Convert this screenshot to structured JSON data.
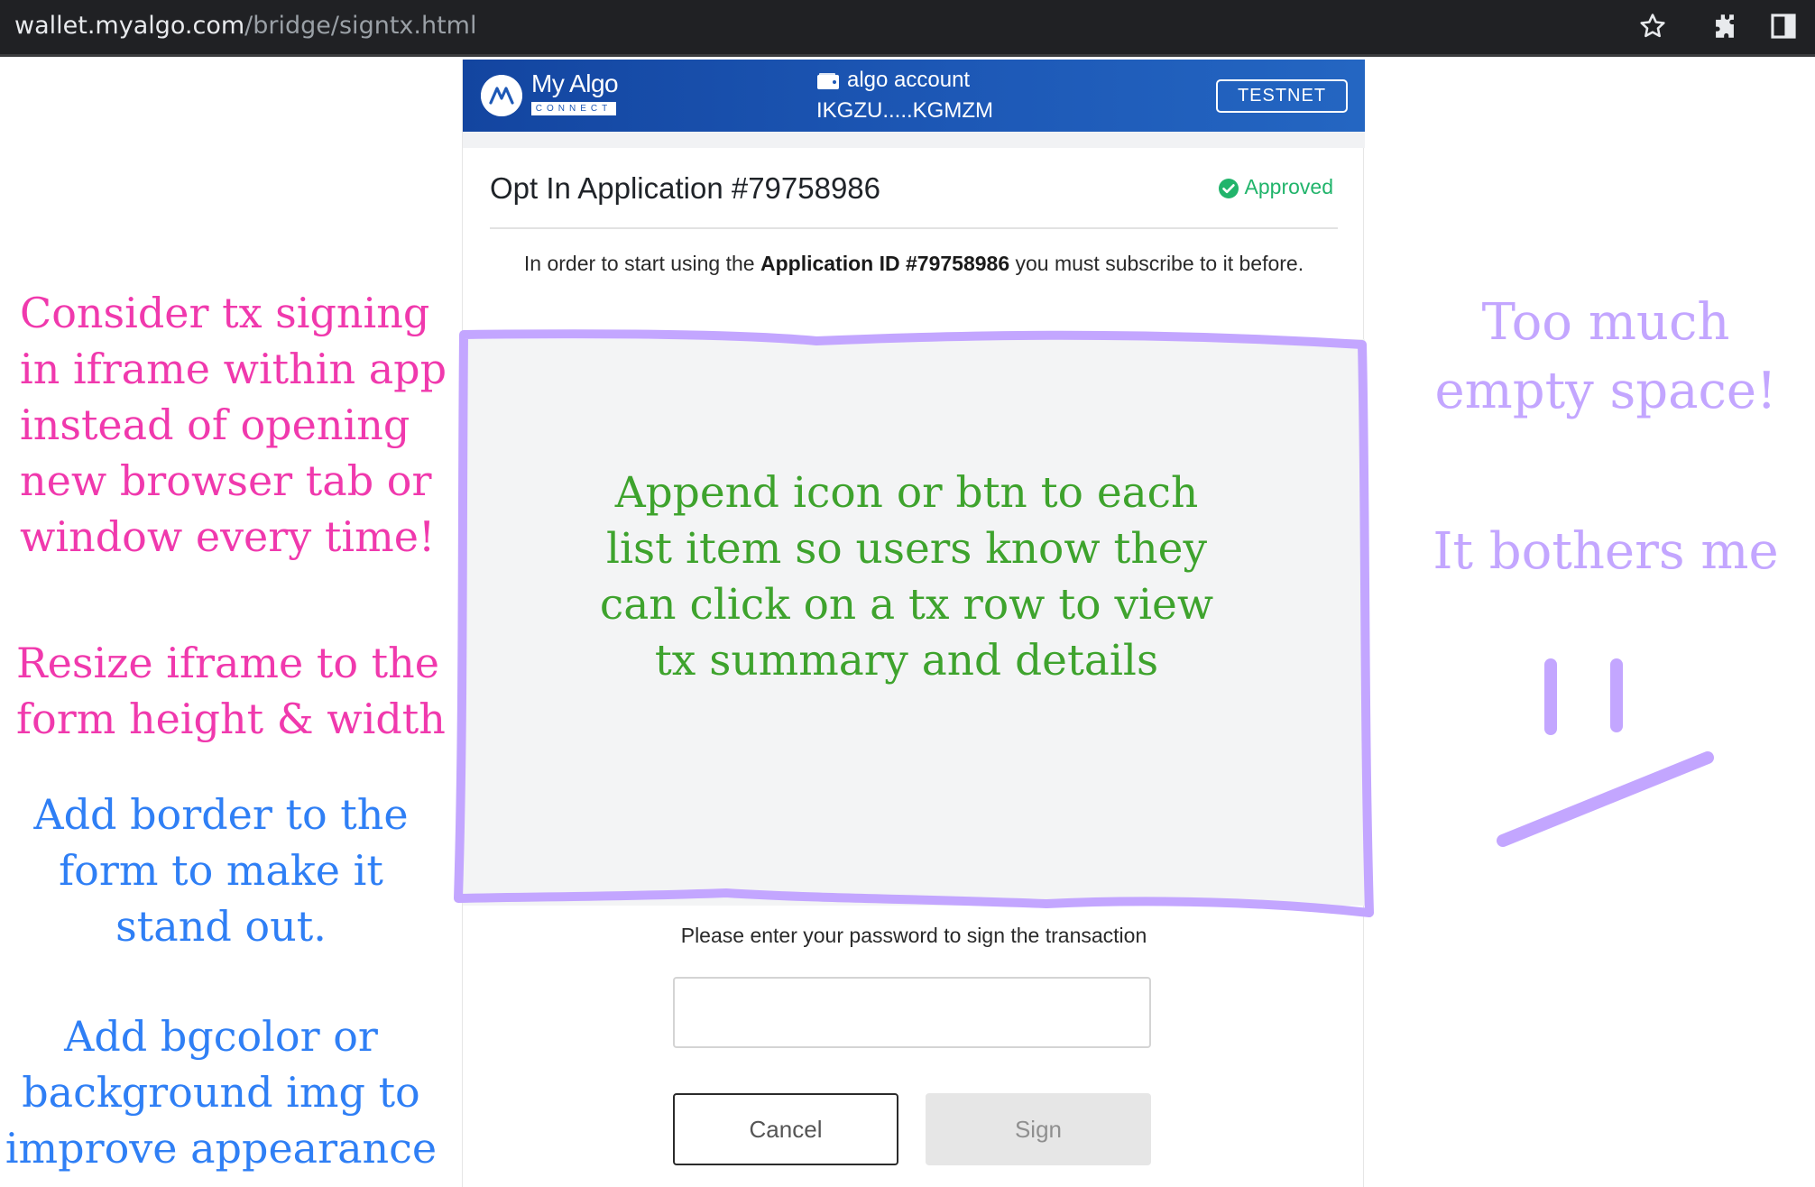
{
  "browser": {
    "url_host": "wallet.myalgo.com",
    "url_path": "/bridge/signtx.html",
    "icons": [
      "star-icon",
      "puzzle-icon",
      "sidebar-icon"
    ]
  },
  "header": {
    "logo_text": "My Algo",
    "logo_sub": "CONNECT",
    "account_label": "algo account",
    "account_address": "IKGZU.....KGMZM",
    "network": "TESTNET",
    "accent_color": "#1d58b6"
  },
  "transaction": {
    "title": "Opt In Application #79758986",
    "status": "Approved",
    "status_color": "#21b46b",
    "desc_before": "In order to start using the ",
    "desc_bold": "Application ID #79758986",
    "desc_after": " you must subscribe to it before."
  },
  "form": {
    "password_label": "Please enter your password to sign the transaction",
    "password_value": "",
    "cancel_label": "Cancel",
    "sign_label": "Sign"
  },
  "annotations": {
    "left_pink_1": [
      "Consider tx signing",
      "in iframe within app",
      "instead of opening",
      "new browser tab or",
      "window every time!"
    ],
    "left_pink_2": [
      "Resize iframe to the",
      "form height & width"
    ],
    "left_blue_1": [
      "Add border to the",
      "form to make it",
      "stand out."
    ],
    "left_blue_2": [
      "Add bgcolor or",
      "background img to",
      "improve appearance"
    ],
    "center_green": [
      "Append icon or btn to each",
      "list item so users know they",
      "can click on a tx row to view",
      "tx summary and details"
    ],
    "right_purple_1": [
      "Too much",
      "empty space!"
    ],
    "right_purple_2": "It bothers me",
    "colors": {
      "pink": "#f039ad",
      "blue": "#2f7ff5",
      "green": "#3ea32d",
      "purple": "#c3a6ff"
    }
  }
}
